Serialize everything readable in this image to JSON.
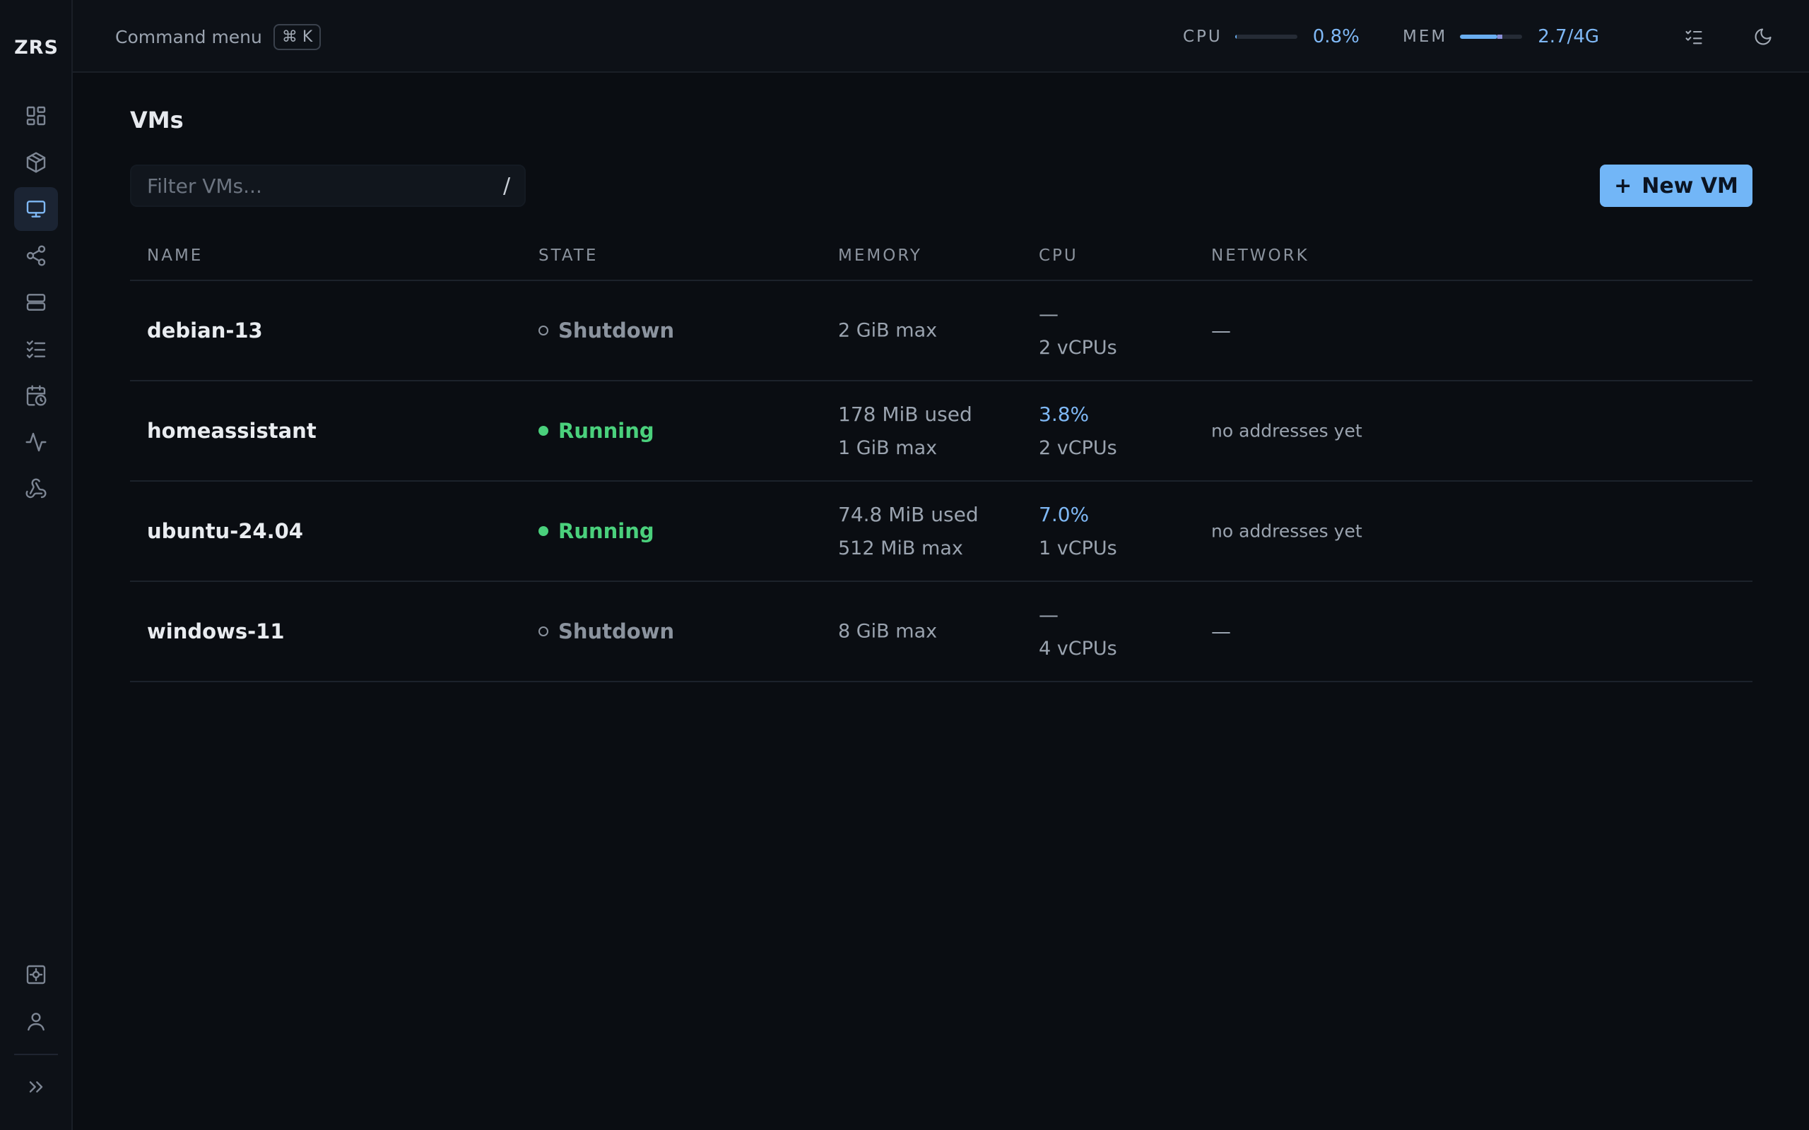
{
  "sidebar": {
    "logo": "ZRS",
    "items": [
      {
        "icon": "dashboard-icon"
      },
      {
        "icon": "package-icon"
      },
      {
        "icon": "monitor-icon",
        "active": true
      },
      {
        "icon": "share-network-icon"
      },
      {
        "icon": "server-icon"
      },
      {
        "icon": "checklist-icon"
      },
      {
        "icon": "calendar-clock-icon"
      },
      {
        "icon": "activity-icon"
      },
      {
        "icon": "webhook-icon"
      }
    ],
    "bottom_items": [
      {
        "icon": "settings-icon"
      },
      {
        "icon": "user-icon"
      },
      {
        "icon": "chevrons-right-icon"
      }
    ]
  },
  "topbar": {
    "command_menu_label": "Command menu",
    "command_menu_shortcut": "⌘ K",
    "cpu": {
      "label": "CPU",
      "value": "0.8%",
      "fraction": 0.008
    },
    "mem": {
      "label": "MEM",
      "value": "2.7/4G",
      "fraction": 0.6,
      "secondary_fraction": 0.08
    },
    "icons": [
      "tasks-icon",
      "moon-icon"
    ]
  },
  "page": {
    "title": "VMs",
    "filter_placeholder": "Filter VMs...",
    "filter_shortcut": "/",
    "new_button_icon": "+",
    "new_button_label": "New VM"
  },
  "table": {
    "headers": {
      "name": "NAME",
      "state": "STATE",
      "memory": "MEMORY",
      "cpu": "CPU",
      "network": "NETWORK"
    },
    "rows": [
      {
        "name": "debian-13",
        "state": "Shutdown",
        "running": false,
        "mem_used": "",
        "mem_max": "2 GiB max",
        "cpu_pct": "—",
        "cpu_vcpus": "2 vCPUs",
        "network": "—"
      },
      {
        "name": "homeassistant",
        "state": "Running",
        "running": true,
        "mem_used": "178 MiB used",
        "mem_max": "1 GiB max",
        "cpu_pct": "3.8%",
        "cpu_vcpus": "2 vCPUs",
        "network": "no addresses yet"
      },
      {
        "name": "ubuntu-24.04",
        "state": "Running",
        "running": true,
        "mem_used": "74.8 MiB used",
        "mem_max": "512 MiB max",
        "cpu_pct": "7.0%",
        "cpu_vcpus": "1 vCPUs",
        "network": "no addresses yet"
      },
      {
        "name": "windows-11",
        "state": "Shutdown",
        "running": false,
        "mem_used": "",
        "mem_max": "8 GiB max",
        "cpu_pct": "—",
        "cpu_vcpus": "4 vCPUs",
        "network": "—"
      }
    ]
  },
  "colors": {
    "accent": "#72b6f7",
    "running": "#4ad07c",
    "muted": "#8b939e",
    "background": "#0a0d12"
  }
}
